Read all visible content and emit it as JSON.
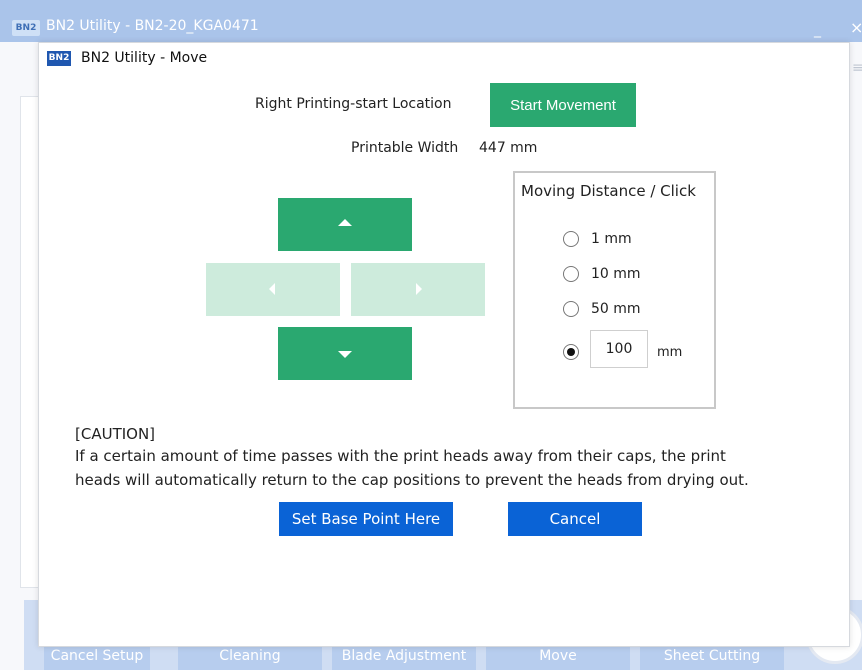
{
  "main_window": {
    "logo": "BN2",
    "title": "BN2 Utility - BN2-20_KGA0471",
    "minimize": "_",
    "close": "×",
    "bottom_buttons": [
      "Cancel Setup",
      "Cleaning",
      "Blade Adjustment",
      "Move",
      "Sheet Cutting"
    ]
  },
  "dialog": {
    "logo": "BN2",
    "title": "BN2 Utility - Move",
    "location_label": "Right Printing-start Location",
    "start_button": "Start Movement",
    "printable_width_label": "Printable Width",
    "printable_width_value": "447 mm",
    "distance": {
      "title": "Moving Distance / Click",
      "options": [
        "1 mm",
        "10 mm",
        "50 mm"
      ],
      "custom_value": "100",
      "custom_unit": "mm",
      "selected": "custom"
    },
    "caution_title": "[CAUTION]",
    "caution_line1": "If a certain amount of time passes with the print heads away from their caps, the print",
    "caution_line2": "heads will automatically return to the cap positions to prevent the heads from drying out.",
    "set_base_button": "Set Base Point Here",
    "cancel_button": "Cancel"
  },
  "colors": {
    "green": "#2aa870",
    "green_disabled": "#cdebdc",
    "blue": "#0a63d6",
    "titlebar": "#aac4ea"
  }
}
